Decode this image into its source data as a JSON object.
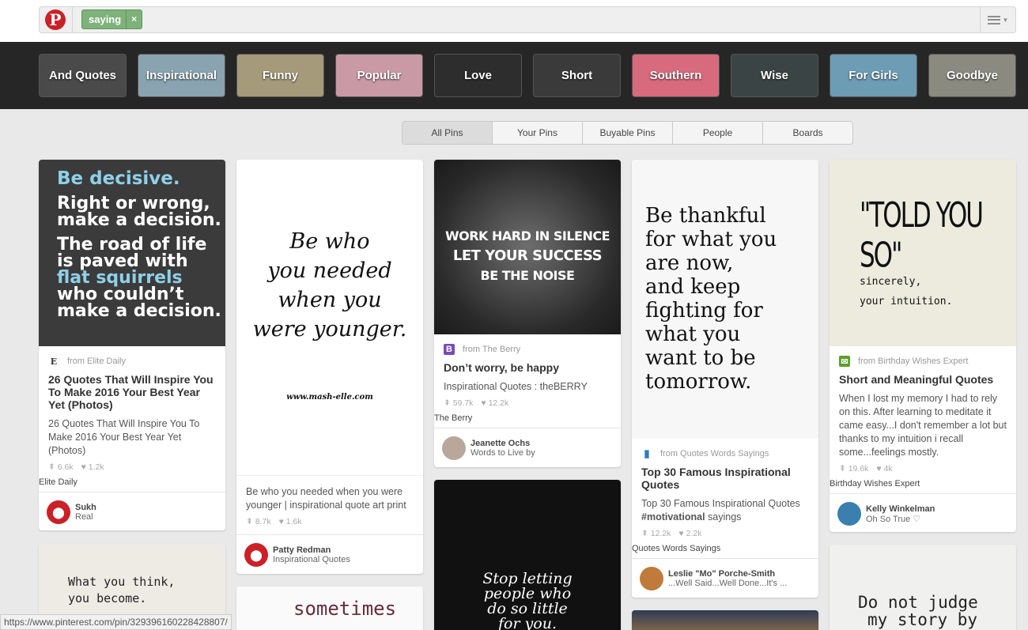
{
  "search": {
    "chip_label": "saying",
    "chip_remove": "×"
  },
  "guides": [
    {
      "label": "And Quotes",
      "bg": "#4a4a4a"
    },
    {
      "label": "Inspirational",
      "bg": "#8aa3b0"
    },
    {
      "label": "Funny",
      "bg": "#a59a7a"
    },
    {
      "label": "Popular",
      "bg": "#c99aa6"
    },
    {
      "label": "Love",
      "bg": "#2d2d2d"
    },
    {
      "label": "Short",
      "bg": "#3a3a3a"
    },
    {
      "label": "Southern",
      "bg": "#d86a7e"
    },
    {
      "label": "Wise",
      "bg": "#3b4444"
    },
    {
      "label": "For Girls",
      "bg": "#6d9cb5"
    },
    {
      "label": "Goodbye",
      "bg": "#8a8a80"
    }
  ],
  "tabs": [
    "All Pins",
    "Your Pins",
    "Buyable Pins",
    "People",
    "Boards"
  ],
  "pins": {
    "p1": {
      "img_lines": [
        "Be decisive.",
        "Right or wrong,",
        "make a decision.",
        "The road of life",
        "is paved with",
        "flat squirrels",
        "who couldn’t",
        "make a decision."
      ],
      "from": "from Elite Daily",
      "title": "26 Quotes That Will Inspire You To Make 2016 Your Best Year Yet (Photos)",
      "desc": "26 Quotes That Will Inspire You To Make 2016 Your Best Year Yet (Photos)",
      "repins": "6.6k",
      "likes": "1.2k",
      "credit": "Elite Daily",
      "pinner": "Sukh",
      "board": "Real"
    },
    "p2": {
      "img_lines": [
        "Be who",
        "you needed",
        "when you",
        "were younger."
      ],
      "img_url": "www.mash-elle.com",
      "desc": "Be who you needed when you were younger | inspirational quote art print",
      "repins": "8.7k",
      "likes": "1.6k",
      "pinner": "Patty Redman",
      "board": "Inspirational Quotes"
    },
    "p3": {
      "img_lines": [
        "WORK HARD IN SILENCE",
        "LET YOUR SUCCESS",
        "BE THE NOISE"
      ],
      "from": "from The Berry",
      "title": "Don’t worry, be happy",
      "desc": "Inspirational Quotes : theBERRY",
      "repins": "59.7k",
      "likes": "12.2k",
      "credit": "The Berry",
      "pinner": "Jeanette Ochs",
      "board": "Words to Live by"
    },
    "p4": {
      "img_lines": [
        "Be thankful",
        "for what you",
        "are now,",
        "and keep",
        "fighting for",
        "what you",
        "want to be",
        "tomorrow."
      ],
      "from": "from Quotes Words Sayings",
      "title": "Top 30 Famous Inspirational Quotes",
      "desc_pre": "Top 30 Famous Inspirational Quotes ",
      "desc_tag": "#motivational",
      "desc_post": " sayings",
      "repins": "12.2k",
      "likes": "2.2k",
      "credit": "Quotes Words Sayings",
      "pinner": "Leslie \"Mo\" Porche-Smith",
      "board": "...Well Said...Well Done...It's ..."
    },
    "p5": {
      "img_lines": [
        "\"TOLD YOU SO\"",
        "sincerely,",
        "your intuition."
      ],
      "from": "from Birthday Wishes Expert",
      "title": "Short and Meaningful Quotes",
      "desc": "When I lost my memory I had to rely on this. After learning to meditate it came easy...I don't remember a lot but thanks to my intuition i recall some...feelings mostly.",
      "repins": "19.6k",
      "likes": "4k",
      "credit": "Birthday Wishes Expert",
      "pinner": "Kelly Winkelman",
      "board": "Oh So True ♡"
    },
    "p6": {
      "img_lines": [
        "What you think,",
        "you become."
      ]
    },
    "p7": {
      "img_lines": [
        "sometimes"
      ]
    },
    "p8": {
      "img_lines": [
        "Stop letting",
        "people who",
        "do so little",
        "for you."
      ]
    },
    "p10": {
      "img_lines": [
        "Do not judge",
        "my story by"
      ]
    }
  },
  "status_url": "https://www.pinterest.com/pin/329396160228428807/",
  "colors": {
    "brand": "#cb2027",
    "chip": "#7fb27a",
    "highlight": "#8fd0e8"
  }
}
